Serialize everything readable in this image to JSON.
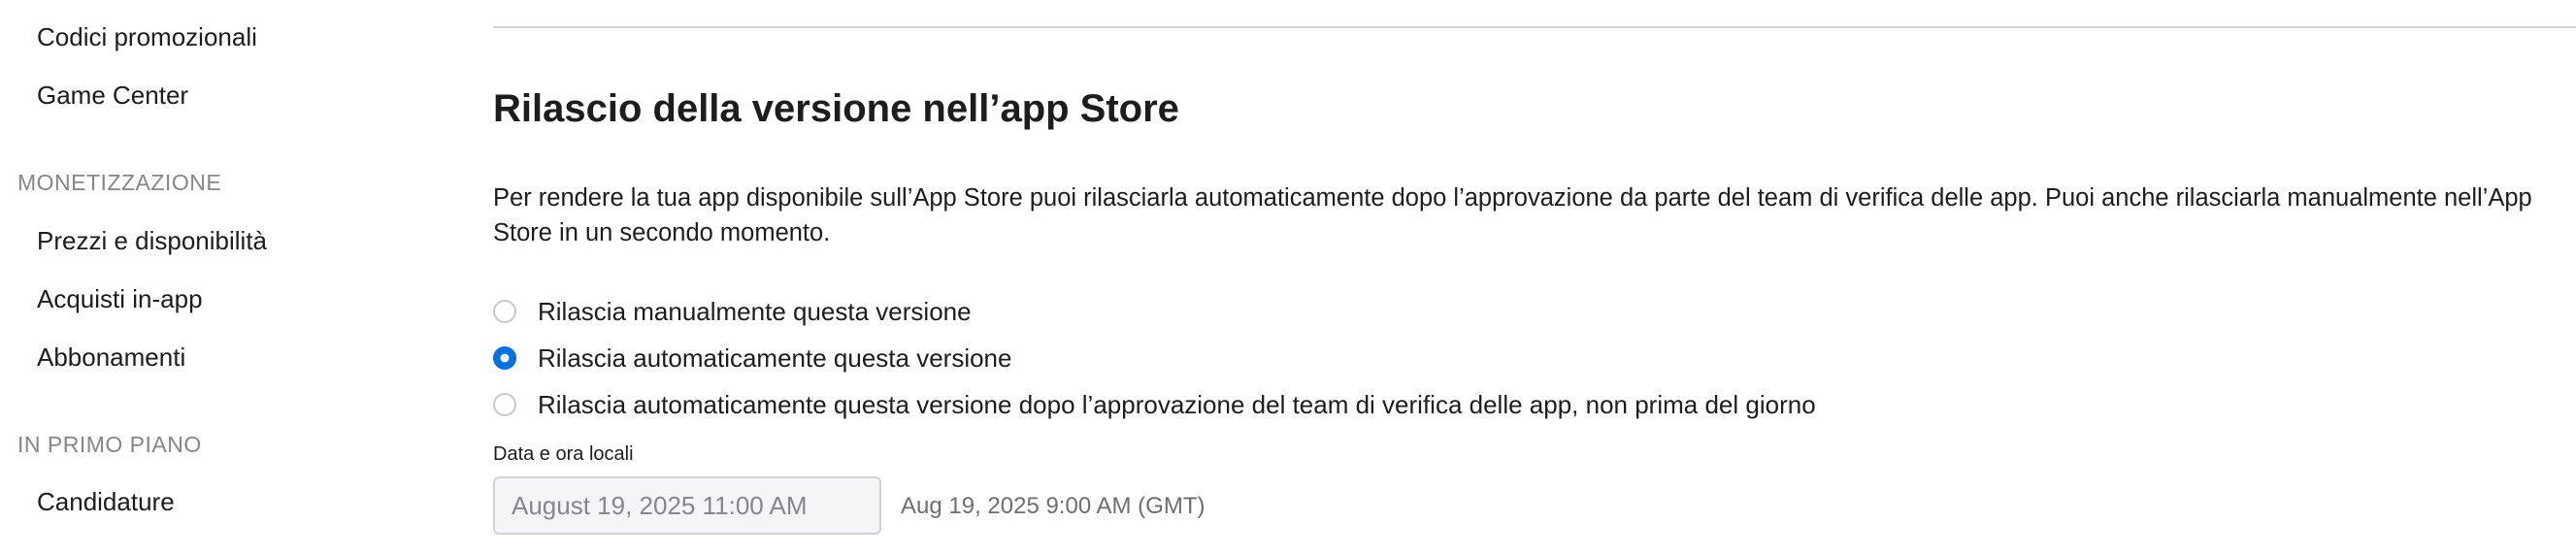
{
  "sidebar": {
    "items_top": [
      {
        "label": "Codici promozionali"
      },
      {
        "label": "Game Center"
      }
    ],
    "sections": [
      {
        "header": "MONETIZZAZIONE",
        "items": [
          {
            "label": "Prezzi e disponibilità"
          },
          {
            "label": "Acquisti in-app"
          },
          {
            "label": "Abbonamenti"
          }
        ]
      },
      {
        "header": "IN PRIMO PIANO",
        "items": [
          {
            "label": "Candidature"
          }
        ]
      }
    ]
  },
  "main": {
    "title": "Rilascio della versione nell’app Store",
    "description": "Per rendere la tua app disponibile sull’App Store puoi rilasciarla automaticamente dopo l’approvazione da parte del team di verifica delle app. Puoi anche rilasciarla manualmente nell’App Store in un secondo momento.",
    "release_options": [
      {
        "label": "Rilascia manualmente questa versione",
        "selected": false
      },
      {
        "label": "Rilascia automaticamente questa versione",
        "selected": true
      },
      {
        "label": "Rilascia automaticamente questa versione dopo l’approvazione del team di verifica delle app, non prima del giorno",
        "selected": false
      }
    ],
    "datetime_field": {
      "label": "Data e ora locali",
      "placeholder": "August 19, 2025 11:00 AM",
      "gmt_text": "Aug 19, 2025 9:00 AM (GMT)"
    }
  },
  "colors": {
    "accent": "#0071e3",
    "section_header": "#86868b",
    "divider": "#d2d2d7"
  }
}
